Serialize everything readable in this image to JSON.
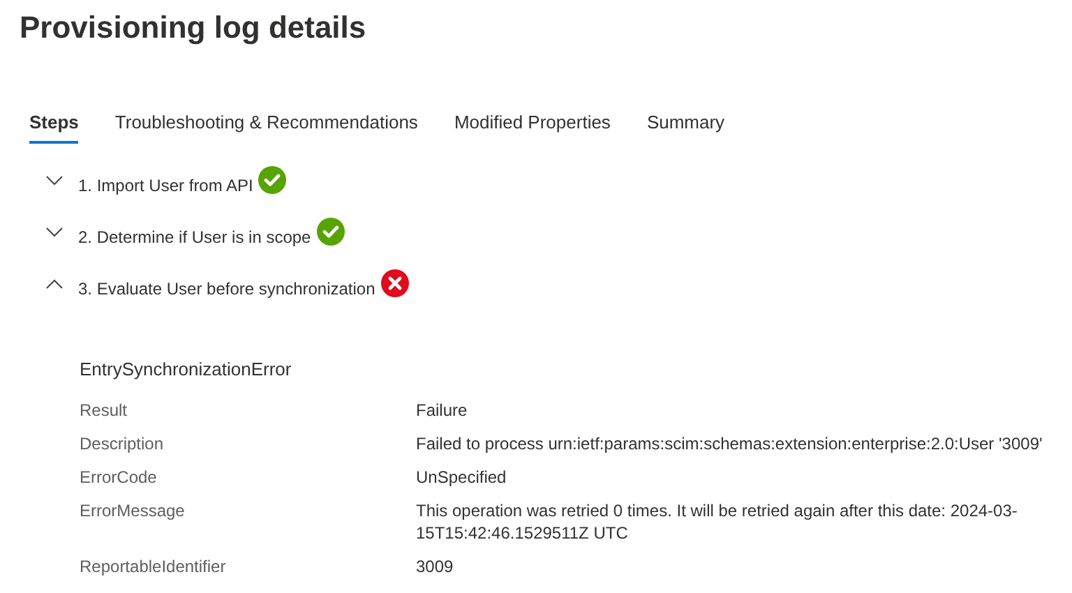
{
  "title": "Provisioning log details",
  "tabs": [
    {
      "label": "Steps",
      "selected": true
    },
    {
      "label": "Troubleshooting & Recommendations",
      "selected": false
    },
    {
      "label": "Modified Properties",
      "selected": false
    },
    {
      "label": "Summary",
      "selected": false
    }
  ],
  "steps": [
    {
      "label": "1. Import User from API",
      "expanded": false,
      "kind": "success"
    },
    {
      "label": "2. Determine if User is in scope",
      "expanded": false,
      "kind": "success"
    },
    {
      "label": "3. Evaluate User before synchronization",
      "expanded": true,
      "kind": "error"
    }
  ],
  "details": {
    "heading": "EntrySynchronizationError",
    "rows": [
      {
        "label": "Result",
        "value": "Failure"
      },
      {
        "label": "Description",
        "value": "Failed to process urn:ietf:params:scim:schemas:extension:enterprise:2.0:User '3009'"
      },
      {
        "label": "ErrorCode",
        "value": "UnSpecified"
      },
      {
        "label": "ErrorMessage",
        "value": "This operation was retried 0 times. It will be retried again after this date: 2024-03-15T15:42:46.1529511Z UTC"
      },
      {
        "label": "ReportableIdentifier",
        "value": "3009"
      }
    ]
  }
}
